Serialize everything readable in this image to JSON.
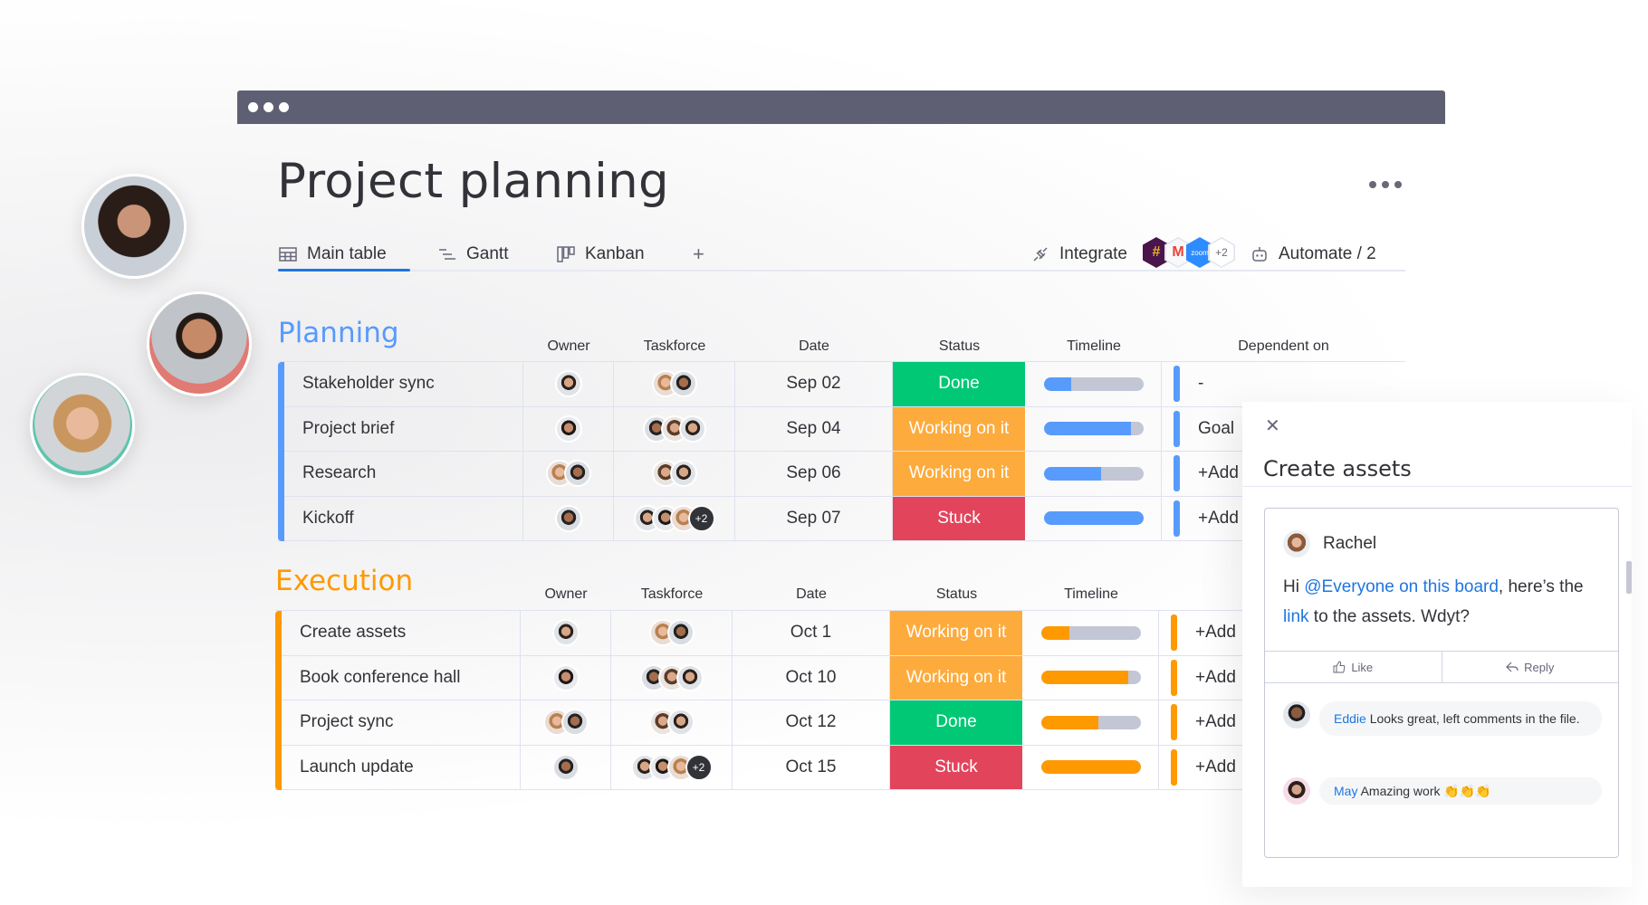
{
  "window": {
    "controls": [
      "dot",
      "dot",
      "dot"
    ]
  },
  "header": {
    "title": "Project planning",
    "more_icon": "more-dots-icon"
  },
  "tabs": [
    {
      "label": "Main table",
      "icon": "table-icon",
      "active": true
    },
    {
      "label": "Gantt",
      "icon": "gantt-icon",
      "active": false
    },
    {
      "label": "Kanban",
      "icon": "kanban-icon",
      "active": false
    }
  ],
  "add_view_label": "+",
  "integrate": {
    "label": "Integrate",
    "icon": "plug-icon",
    "apps": [
      "Slack",
      "Gmail",
      "zoom"
    ],
    "more": "+2"
  },
  "automate": {
    "label": "Automate / 2",
    "icon": "robot-icon"
  },
  "colors": {
    "planning": "#579bfc",
    "execution": "#ff9900",
    "done": "#00c875",
    "working": "#fdab3d",
    "stuck": "#e2445c",
    "track": "#c3c6d4",
    "link": "#1f76e1",
    "titlebar": "#5e5f72"
  },
  "columns": {
    "owner": "Owner",
    "taskforce": "Taskforce",
    "date": "Date",
    "status": "Status",
    "timeline": "Timeline",
    "dependent": "Dependent on"
  },
  "groups": [
    {
      "name": "Planning",
      "color_key": "planning",
      "rows": [
        {
          "task": "Stakeholder sync",
          "owner_count": 1,
          "taskforce_count": 2,
          "taskforce_more": "",
          "date": "Sep 02",
          "status": "Done",
          "status_key": "done",
          "timeline_progress": 0.28,
          "dependent": "-"
        },
        {
          "task": "Project brief",
          "owner_count": 1,
          "taskforce_count": 3,
          "taskforce_more": "",
          "date": "Sep 04",
          "status": "Working on it",
          "status_key": "working",
          "timeline_progress": 0.88,
          "dependent": "Goal"
        },
        {
          "task": "Research",
          "owner_count": 2,
          "taskforce_count": 2,
          "taskforce_more": "",
          "date": "Sep 06",
          "status": "Working on it",
          "status_key": "working",
          "timeline_progress": 0.58,
          "dependent": "+Add"
        },
        {
          "task": "Kickoff",
          "owner_count": 1,
          "taskforce_count": 3,
          "taskforce_more": "+2",
          "date": "Sep 07",
          "status": "Stuck",
          "status_key": "stuck",
          "timeline_progress": 1.0,
          "dependent": "+Add"
        }
      ]
    },
    {
      "name": "Execution",
      "color_key": "execution",
      "rows": [
        {
          "task": "Create assets",
          "owner_count": 1,
          "taskforce_count": 2,
          "taskforce_more": "",
          "date": "Oct 1",
          "status": "Working on it",
          "status_key": "working",
          "timeline_progress": 0.29,
          "dependent": "+Add"
        },
        {
          "task": "Book conference hall",
          "owner_count": 1,
          "taskforce_count": 3,
          "taskforce_more": "",
          "date": "Oct 10",
          "status": "Working on it",
          "status_key": "working",
          "timeline_progress": 0.88,
          "dependent": "+Add"
        },
        {
          "task": "Project sync",
          "owner_count": 2,
          "taskforce_count": 2,
          "taskforce_more": "",
          "date": "Oct 12",
          "status": "Done",
          "status_key": "done",
          "timeline_progress": 0.58,
          "dependent": "+Add"
        },
        {
          "task": "Launch update",
          "owner_count": 1,
          "taskforce_count": 3,
          "taskforce_more": "+2",
          "date": "Oct 15",
          "status": "Stuck",
          "status_key": "stuck",
          "timeline_progress": 1.0,
          "dependent": "+Add"
        }
      ]
    }
  ],
  "panel": {
    "close_icon": "close-icon",
    "title": "Create assets",
    "post": {
      "author": "Rachel",
      "text_before": "Hi ",
      "mention": "@Everyone on this board",
      "text_middle": ", here’s the ",
      "link": "link",
      "text_after": " to the assets. Wdyt?"
    },
    "actions": {
      "like": "Like",
      "reply": "Reply"
    },
    "replies": [
      {
        "author": "Eddie",
        "text": " Looks great, left comments in the file."
      },
      {
        "author": "May",
        "text": " Amazing work 👏👏👏"
      }
    ]
  }
}
